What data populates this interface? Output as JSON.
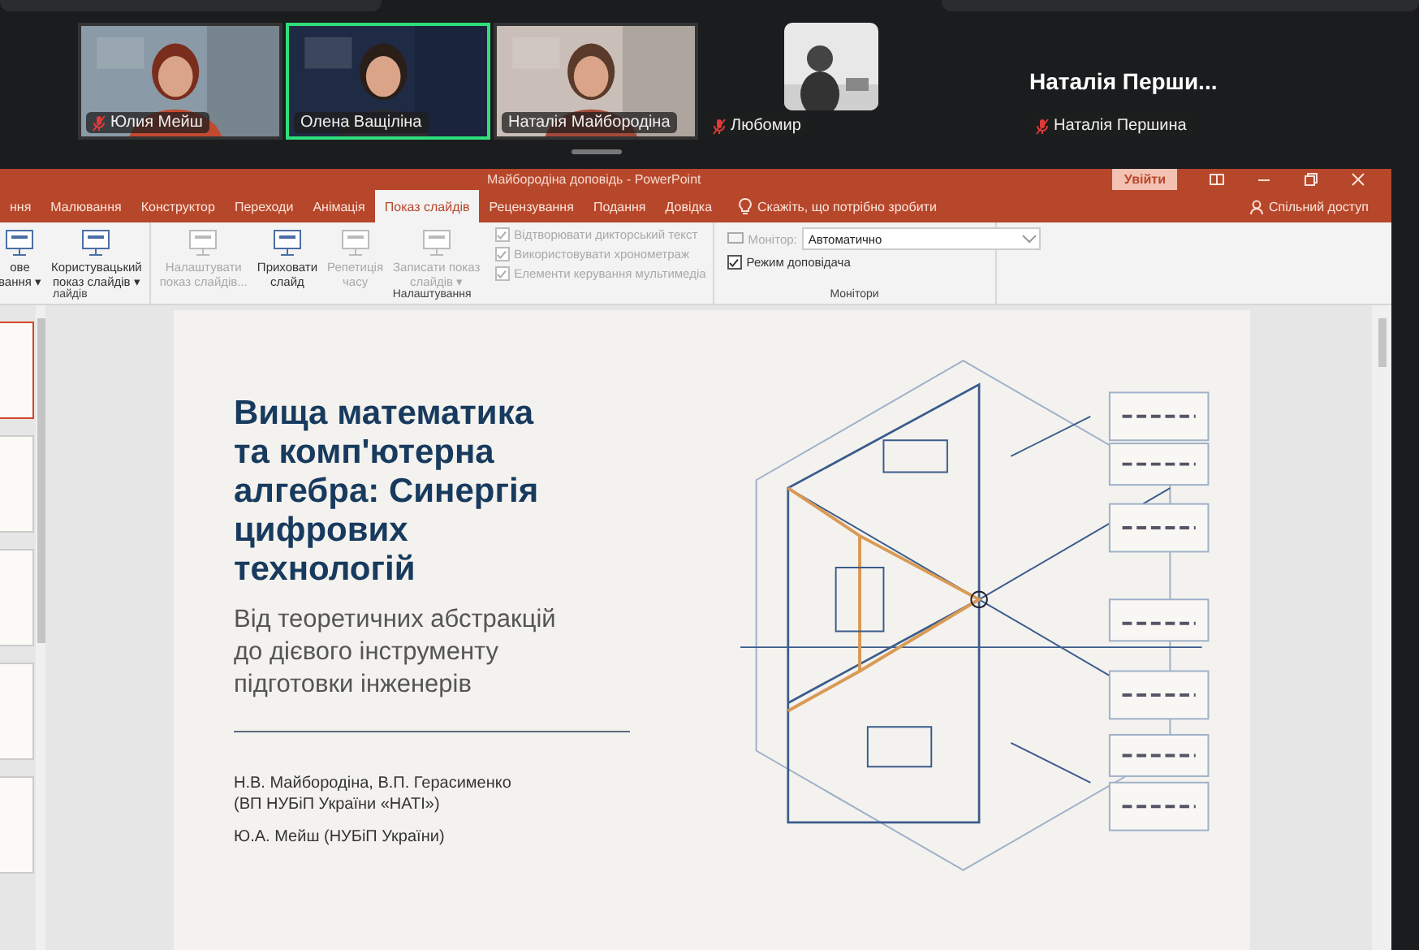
{
  "meeting": {
    "participants": [
      {
        "name": "Юлия Мейш",
        "kind": "video",
        "muted": true,
        "speaking": false
      },
      {
        "name": "Олена Ващіліна",
        "kind": "video",
        "muted": false,
        "speaking": true
      },
      {
        "name": "Наталія Майбородіна",
        "kind": "video",
        "muted": false,
        "speaking": false
      },
      {
        "name": "Любомир",
        "kind": "avatar",
        "muted": true,
        "speaking": false
      }
    ],
    "overflow": {
      "heading": "Наталія Перши...",
      "name": "Наталія Першина",
      "muted": true
    }
  },
  "powerpoint": {
    "title": "Майбородіна доповідь  -  PowerPoint",
    "sign_in": "Увійти",
    "tabs": [
      {
        "label": "ння",
        "selected": false
      },
      {
        "label": "Малювання",
        "selected": false
      },
      {
        "label": "Конструктор",
        "selected": false
      },
      {
        "label": "Переходи",
        "selected": false
      },
      {
        "label": "Анімація",
        "selected": false
      },
      {
        "label": "Показ слайдів",
        "selected": true
      },
      {
        "label": "Рецензування",
        "selected": false
      },
      {
        "label": "Подання",
        "selected": false
      },
      {
        "label": "Довідка",
        "selected": false
      }
    ],
    "tell_me": "Скажіть, що потрібно зробити",
    "share": "Спільний доступ",
    "ribbon": [
      {
        "label": "лайдів",
        "items": [
          {
            "kind": "button",
            "lines": [
              "ове",
              "вання ▾"
            ],
            "disabled": false
          },
          {
            "kind": "button",
            "lines": [
              "Користувацький",
              "показ слайдів ▾"
            ],
            "disabled": false
          }
        ]
      },
      {
        "label": "Налаштування",
        "items": [
          {
            "kind": "button",
            "lines": [
              "Налаштувати",
              "показ слайдів..."
            ],
            "disabled": true
          },
          {
            "kind": "button",
            "lines": [
              "Приховати",
              "слайд"
            ],
            "disabled": false
          },
          {
            "kind": "button",
            "lines": [
              "Репетиція",
              "часу"
            ],
            "disabled": true
          },
          {
            "kind": "button",
            "lines": [
              "Записати показ",
              "слайдів ▾"
            ],
            "disabled": true
          },
          {
            "kind": "checks",
            "checks": [
              {
                "label": "Відтворювати дикторський текст",
                "checked": true,
                "disabled": true
              },
              {
                "label": "Використовувати хронометраж",
                "checked": true,
                "disabled": true
              },
              {
                "label": "Елементи керування мультимедіа",
                "checked": true,
                "disabled": true
              }
            ]
          }
        ]
      },
      {
        "label": "Монітори",
        "items": [
          {
            "kind": "monitor",
            "label": "Монітор:",
            "value": "Автоматично",
            "checks": [
              {
                "label": "Режим доповідача",
                "checked": true,
                "disabled": false
              }
            ]
          }
        ]
      }
    ],
    "thumbnails": [
      {
        "selected": true
      },
      {
        "selected": false
      },
      {
        "selected": false
      },
      {
        "selected": false
      },
      {
        "selected": false
      }
    ],
    "slide": {
      "title": "Вища математика\nта комп'ютерна\nалгебра: Синергія\nцифрових\nтехнологій",
      "subtitle": "Від теоретичних абстракцій\nдо дієвого інструменту\nпідготовки інженерів",
      "authors": [
        "Н.В. Майбородіна, В.П. Герасименко\n(ВП НУБіП України «НАТІ»)",
        "Ю.А. Мейш (НУБіП України)"
      ]
    }
  }
}
